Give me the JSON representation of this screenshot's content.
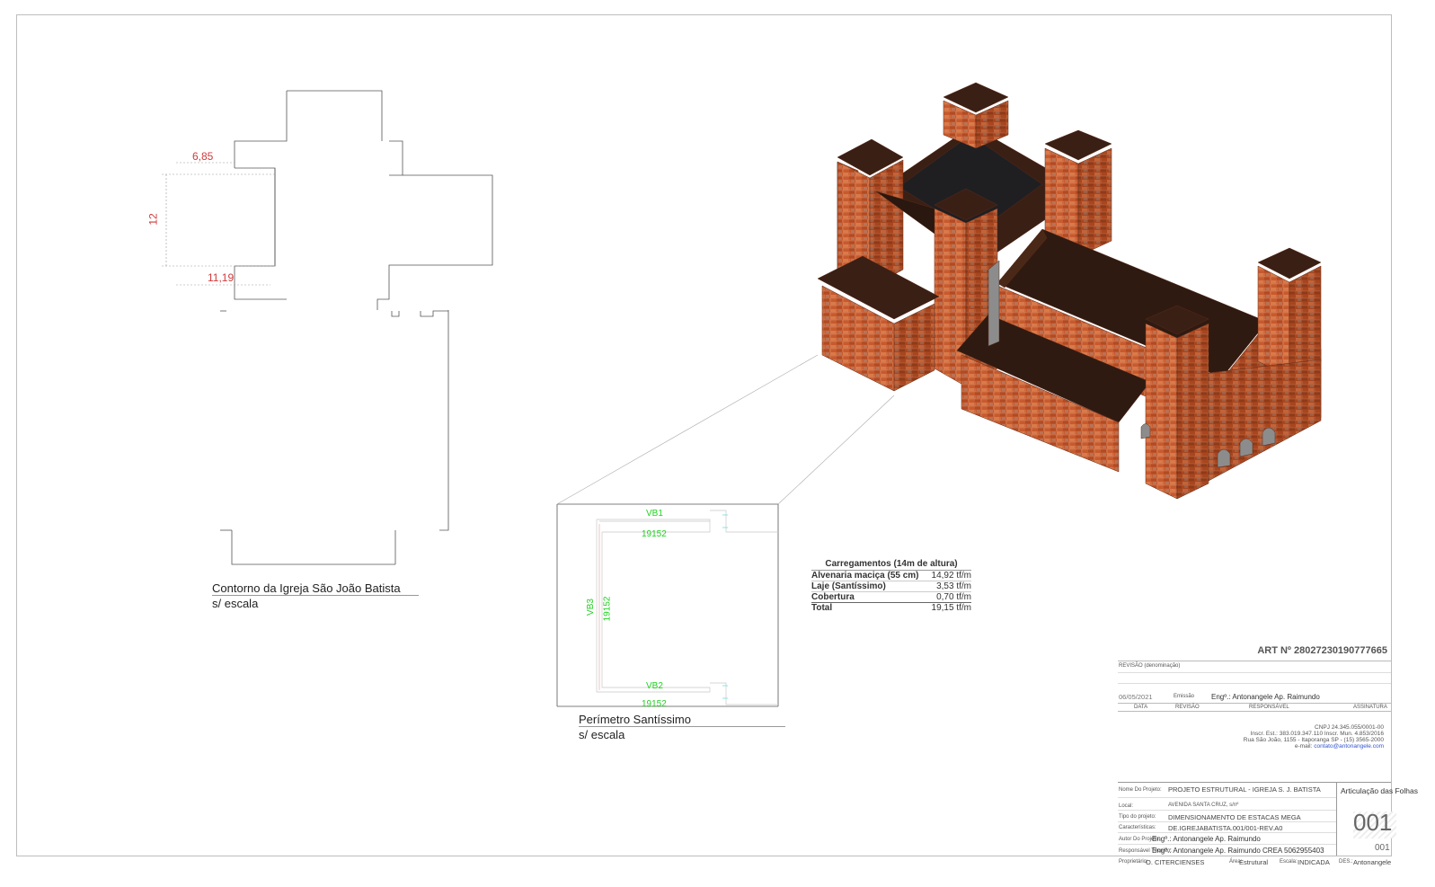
{
  "outline": {
    "dim_top": "6,85",
    "dim_left": "12",
    "dim_bottom": "11,19",
    "caption_title": "Contorno da Igreja São João Batista",
    "caption_scale": "s/ escala"
  },
  "perimeter": {
    "beam_top": "VB1",
    "beam_top_len": "19152",
    "beam_left": "VB3",
    "beam_left_len": "19152",
    "beam_bottom": "VB2",
    "beam_bottom_len": "19152",
    "caption_title": "Perímetro Santíssimo",
    "caption_scale": "s/ escala"
  },
  "loads": {
    "title": "Carregamentos (14m de altura)",
    "rows": [
      {
        "label": "Alvenaria maciça (55 cm)",
        "value": "14,92 tf/m"
      },
      {
        "label": "Laje (Santíssimo)",
        "value": "3,53 tf/m"
      },
      {
        "label": "Cobertura",
        "value": "0,70 tf/m"
      },
      {
        "label": "Total",
        "value": "19,15 tf/m"
      }
    ]
  },
  "title_block": {
    "art": "ART Nº 28027230190777665",
    "revision_label": "REVISÃO (denominação)",
    "rev_date": "06/05/2021",
    "rev_type": "Emissão",
    "rev_responsible": "Engº.: Antonangele Ap. Raimundo",
    "col_date": "DATA",
    "col_revision": "REVISÃO",
    "col_responsible": "RESPONSÁVEL",
    "col_signature": "ASSINATURA",
    "cnpj": "CNPJ 24.345.055/0001-00",
    "inscr": "Inscr. Est.: 383.019.347.110 Inscr. Mun. 4.853/2016",
    "address": "Rua São João, 1155 - Itaporanga SP - (15) 3565-2000",
    "email_label": "e-mail: ",
    "email": "contato@antonangele.com",
    "project_name_label": "Nome Do Projeto:",
    "project_name": "PROJETO ESTRUTURAL - IGREJA S. J. BATISTA",
    "location_label": "Local:",
    "location": "AVENIDA SANTA CRUZ, s/nº",
    "project_type_label": "Tipo do projeto:",
    "project_type": "DIMENSIONAMENTO DE ESTACAS MEGA",
    "features_label": "Características:",
    "features": "DE.IGREJABATISTA.001/001-REV.A0",
    "author_label": "Autor Do Projeto:",
    "author": "Engº.: Antonangele Ap. Raimundo",
    "tech_label": "Responsável Técnico:",
    "tech": "Engº.: Antonangele Ap. Raimundo CREA 5062955403",
    "owner_label": "Proprietário:",
    "owner": "O. CITERCIENSES",
    "area_label": "Área:",
    "area": "Estrutural",
    "scale_label": "Escala:",
    "scale": "INDICADA",
    "des_label": "DES.:",
    "des": "Antonangele",
    "sheets_title": "Articulação das Folhas",
    "sheet_big": "001",
    "sheet_small": "001"
  }
}
